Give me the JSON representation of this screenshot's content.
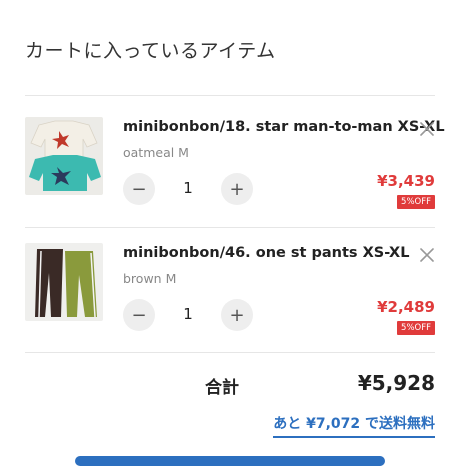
{
  "cart": {
    "title": "カートに入っているアイテム",
    "items": [
      {
        "name": "minibonbon/18. star man-to-man XS-XL",
        "variant": "oatmeal M",
        "quantity": "1",
        "price": "¥3,439",
        "discount_badge": "5%OFF",
        "decrement_label": "−",
        "increment_label": "+"
      },
      {
        "name": "minibonbon/46. one st pants XS-XL",
        "variant": "brown M",
        "quantity": "1",
        "price": "¥2,489",
        "discount_badge": "5%OFF",
        "decrement_label": "−",
        "increment_label": "+"
      }
    ],
    "total_label": "合計",
    "total_value": "¥5,928",
    "free_shipping_message": "あと ¥7,072 で送料無料"
  },
  "colors": {
    "price": "#e03b3b",
    "badge_bg": "#e03b3b",
    "link": "#2c6fbf",
    "divider": "#e6e6e6",
    "qty_button_bg": "#eeeeee"
  },
  "icons": {
    "remove": "close-icon",
    "decrement": "minus-icon",
    "increment": "plus-icon"
  }
}
